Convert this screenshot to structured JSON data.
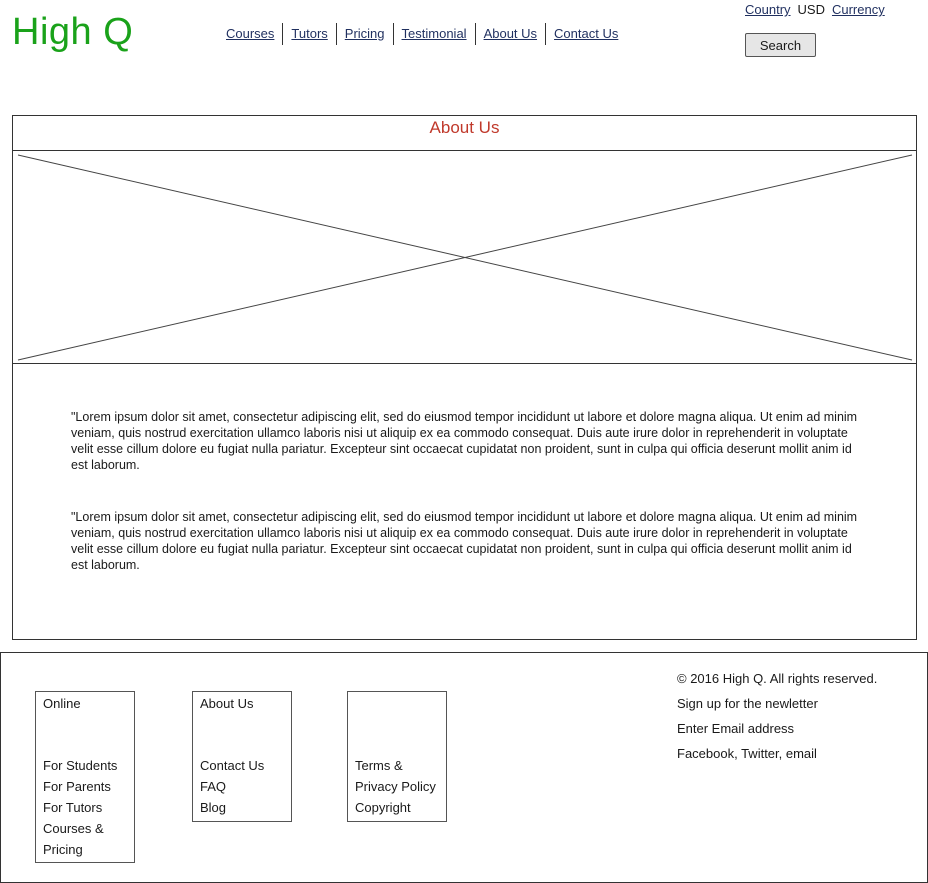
{
  "header": {
    "logo": "High Q",
    "nav": [
      "Courses",
      "Tutors",
      "Pricing",
      "Testimonial",
      "About Us",
      "Contact Us"
    ],
    "locale": {
      "country": "Country",
      "currency_value": "USD",
      "currency": "Currency"
    },
    "search_label": "Search"
  },
  "main": {
    "title": "About Us",
    "paragraphs": [
      "\"Lorem ipsum dolor sit amet, consectetur adipiscing elit, sed do eiusmod tempor incididunt ut labore et dolore magna aliqua. Ut enim ad minim veniam, quis nostrud exercitation ullamco laboris nisi ut aliquip ex ea commodo consequat. Duis aute irure dolor in reprehenderit in voluptate velit esse cillum dolore eu fugiat nulla pariatur. Excepteur sint occaecat cupidatat non proident, sunt in culpa qui officia deserunt mollit anim id est laborum.",
      "\"Lorem ipsum dolor sit amet, consectetur adipiscing elit, sed do eiusmod tempor incididunt ut labore et dolore magna aliqua. Ut enim ad minim veniam, quis nostrud exercitation ullamco laboris nisi ut aliquip ex ea commodo consequat. Duis aute irure dolor in reprehenderit in voluptate velit esse cillum dolore eu fugiat nulla pariatur. Excepteur sint occaecat cupidatat non proident, sunt in culpa qui officia deserunt mollit anim id est laborum."
    ]
  },
  "footer": {
    "col1": [
      "Online",
      "For Students",
      "For Parents",
      "For Tutors",
      "Courses &",
      "Pricing"
    ],
    "col2": [
      "About Us",
      "Contact Us",
      "FAQ",
      "Blog"
    ],
    "col3": [
      "Terms &",
      "Privacy Policy",
      "Copyright"
    ],
    "info": [
      "© 2016 High Q. All rights reserved.",
      "Sign up for the newletter",
      "Enter Email address",
      "Facebook, Twitter, email"
    ]
  },
  "colors": {
    "logo": "#1aa21a",
    "title": "#c0392b",
    "link": "#1f2f5f"
  }
}
